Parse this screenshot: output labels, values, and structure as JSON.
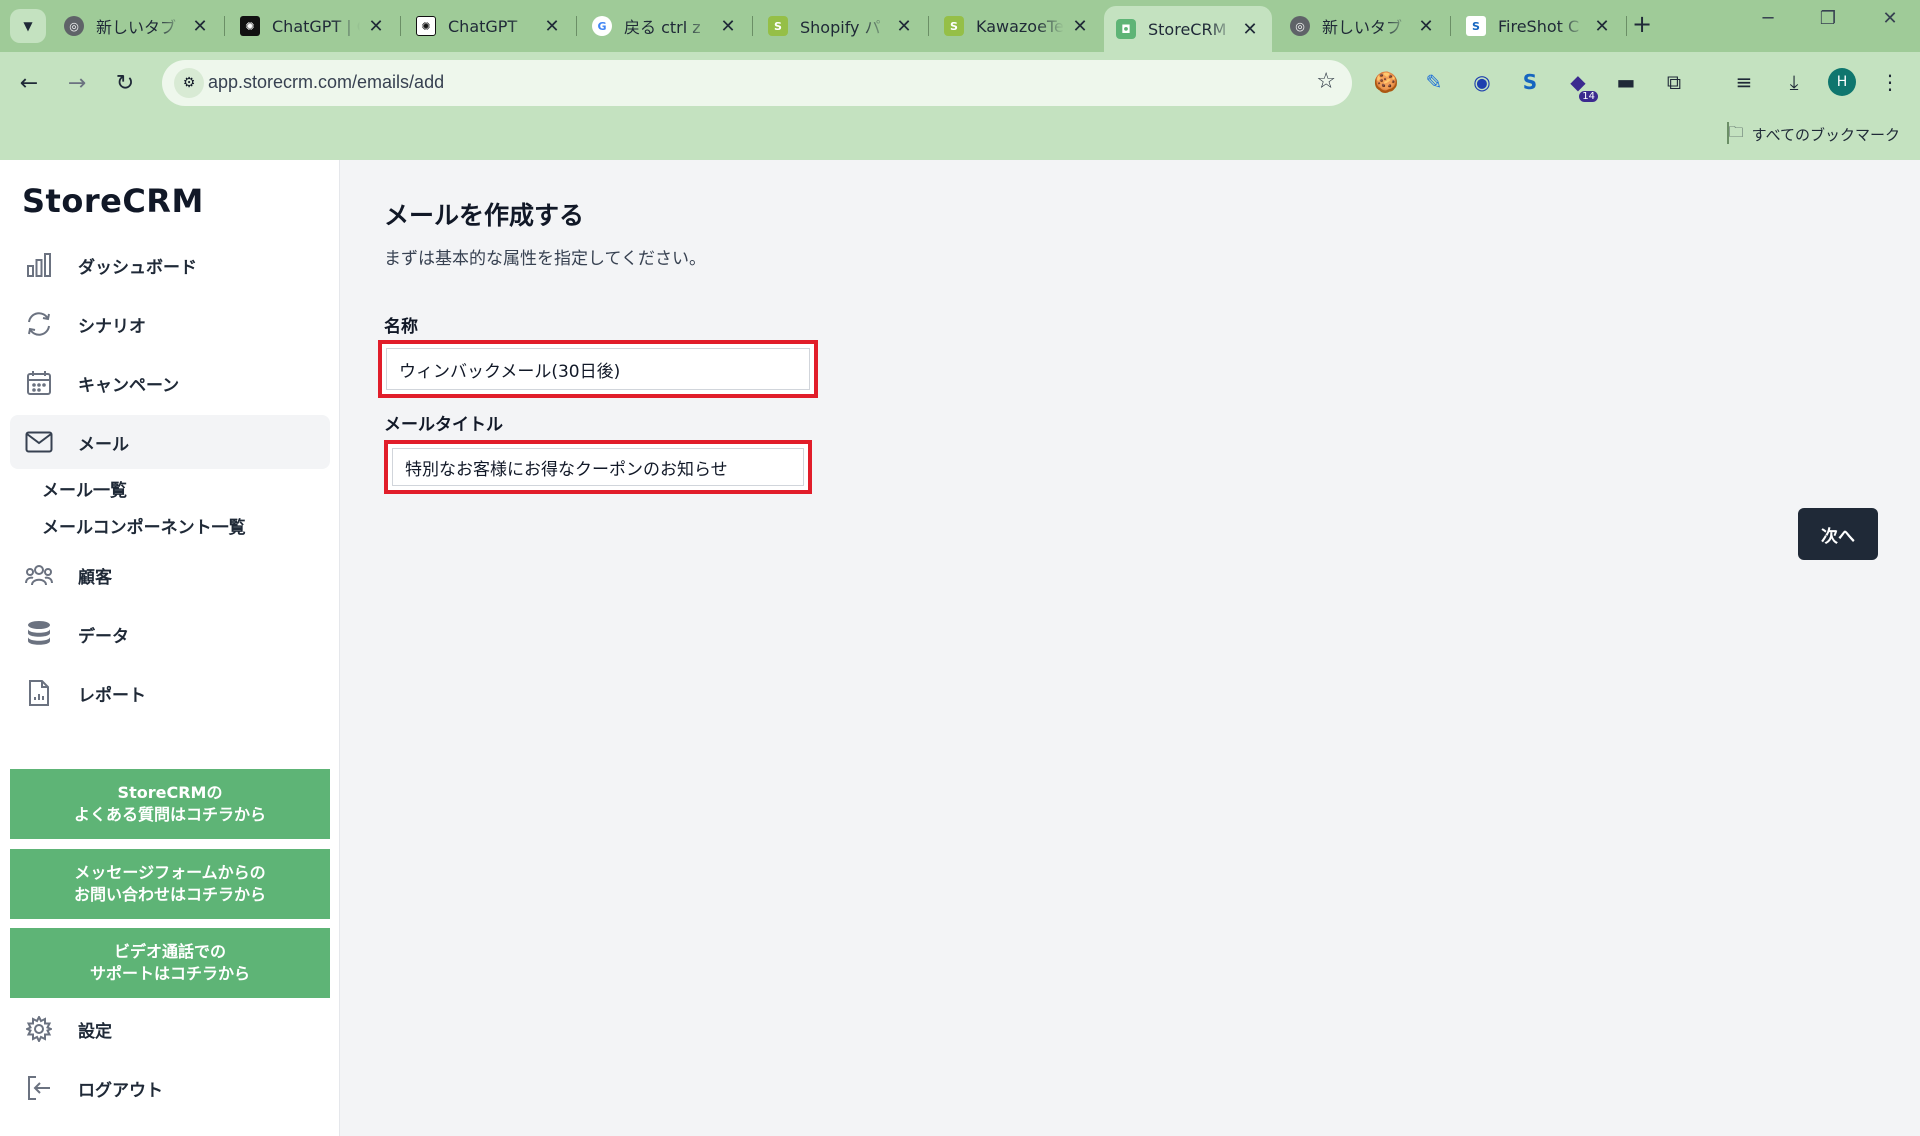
{
  "browser": {
    "tabs": [
      {
        "label": "新しいタブ",
        "icon": "chrome-icon"
      },
      {
        "label": "ChatGPT | C",
        "icon": "openai-icon"
      },
      {
        "label": "ChatGPT",
        "icon": "openai-icon"
      },
      {
        "label": "戻る ctrl z",
        "icon": "google-icon"
      },
      {
        "label": "Shopify パ",
        "icon": "shopify-icon"
      },
      {
        "label": "KawazoeTe",
        "icon": "shopify-icon"
      },
      {
        "label": "StoreCRM",
        "icon": "storecrm-icon"
      },
      {
        "label": "新しいタブ",
        "icon": "chrome-icon"
      },
      {
        "label": "FireShot C",
        "icon": "fireshot-icon"
      }
    ],
    "active_tab_index": 6,
    "url": "app.storecrm.com/emails/add",
    "extension_badge": "14",
    "profile_initial": "H",
    "bookmarks_label": "すべてのブックマーク"
  },
  "sidebar": {
    "brand": "StoreCRM",
    "items": [
      {
        "label": "ダッシュボード",
        "icon": "bar-chart-icon"
      },
      {
        "label": "シナリオ",
        "icon": "refresh-icon"
      },
      {
        "label": "キャンペーン",
        "icon": "calendar-icon"
      },
      {
        "label": "メール",
        "icon": "mail-icon"
      },
      {
        "label": "顧客",
        "icon": "users-icon"
      },
      {
        "label": "データ",
        "icon": "database-icon"
      },
      {
        "label": "レポート",
        "icon": "report-icon"
      }
    ],
    "active_item": "メール",
    "mail_subitems": [
      "メール一覧",
      "メールコンポーネント一覧"
    ],
    "help_buttons": [
      {
        "line1": "StoreCRMの",
        "line2": "よくある質問はコチラから"
      },
      {
        "line1": "メッセージフォームからの",
        "line2": "お問い合わせはコチラから"
      },
      {
        "line1": "ビデオ通話での",
        "line2": "サポートはコチラから"
      }
    ],
    "settings_label": "設定",
    "logout_label": "ログアウト"
  },
  "main": {
    "title": "メールを作成する",
    "subtitle": "まずは基本的な属性を指定してください。",
    "name_label": "名称",
    "name_value": "ウィンバックメール(30日後)",
    "mail_title_label": "メールタイトル",
    "mail_title_value": "特別なお客様にお得なクーポンのお知らせ",
    "next_button": "次へ"
  },
  "colors": {
    "accent_green": "#5eb476",
    "highlight_red": "#e11d2a",
    "dark_button": "#1f2937",
    "chrome_green": "#c4e2c0"
  }
}
